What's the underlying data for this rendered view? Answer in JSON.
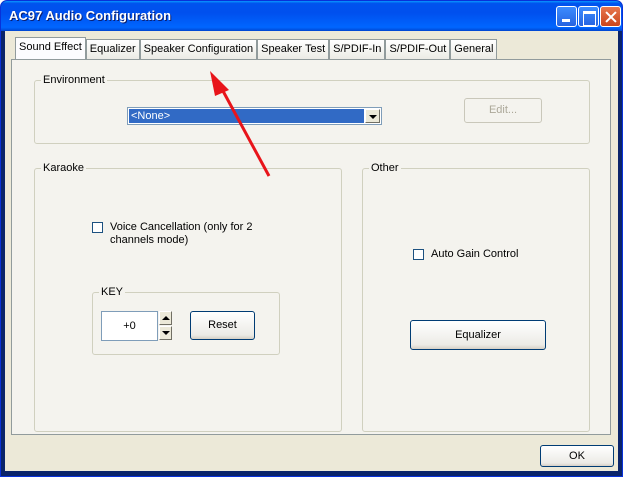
{
  "window": {
    "title": "AC97 Audio Configuration"
  },
  "tabs": [
    {
      "label": "Sound Effect"
    },
    {
      "label": "Equalizer"
    },
    {
      "label": "Speaker Configuration"
    },
    {
      "label": "Speaker Test"
    },
    {
      "label": "S/PDIF-In"
    },
    {
      "label": "S/PDIF-Out"
    },
    {
      "label": "General"
    }
  ],
  "environment": {
    "legend": "Environment",
    "selected": "<None>",
    "edit_label": "Edit..."
  },
  "karaoke": {
    "legend": "Karaoke",
    "voice_cancel_label": "Voice Cancellation (only for 2",
    "voice_cancel_label2": "channels mode)",
    "voice_cancel_checked": false,
    "key_legend": "KEY",
    "key_value": "+0",
    "reset_label": "Reset"
  },
  "other": {
    "legend": "Other",
    "agc_label": "Auto Gain Control",
    "agc_checked": false,
    "equalizer_label": "Equalizer"
  },
  "footer": {
    "ok_label": "OK"
  },
  "colors": {
    "annotation_arrow": "#e8141a",
    "title_bar": "#0055ea"
  }
}
